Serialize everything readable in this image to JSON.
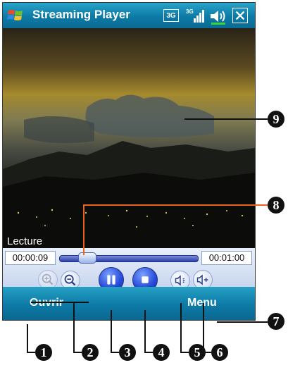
{
  "titlebar": {
    "title": "Streaming Player",
    "network_badge": "3G",
    "start_icon": "windows-flag-icon",
    "signal_icon": "signal-strength-icon",
    "volume_icon": "speaker-icon",
    "close_icon": "close-icon"
  },
  "video": {
    "status": "Lecture"
  },
  "playback": {
    "elapsed": "00:00:09",
    "total": "00:01:00",
    "progress_fraction": 0.15
  },
  "controls": {
    "zoom_in_icon": "zoom-in-icon",
    "zoom_out_icon": "zoom-out-icon",
    "pause_icon": "pause-icon",
    "stop_icon": "stop-icon",
    "volume_down_icon": "volume-down-icon",
    "volume_up_icon": "volume-up-icon"
  },
  "menubar": {
    "left_softkey": "Ouvrir",
    "right_softkey": "Menu"
  },
  "callouts": [
    "1",
    "2",
    "3",
    "4",
    "5",
    "6",
    "7",
    "8",
    "9"
  ],
  "colors": {
    "titlebar": "#0d7aa6",
    "callout_accent": "#e8641e",
    "play_button": "#2648d8"
  }
}
